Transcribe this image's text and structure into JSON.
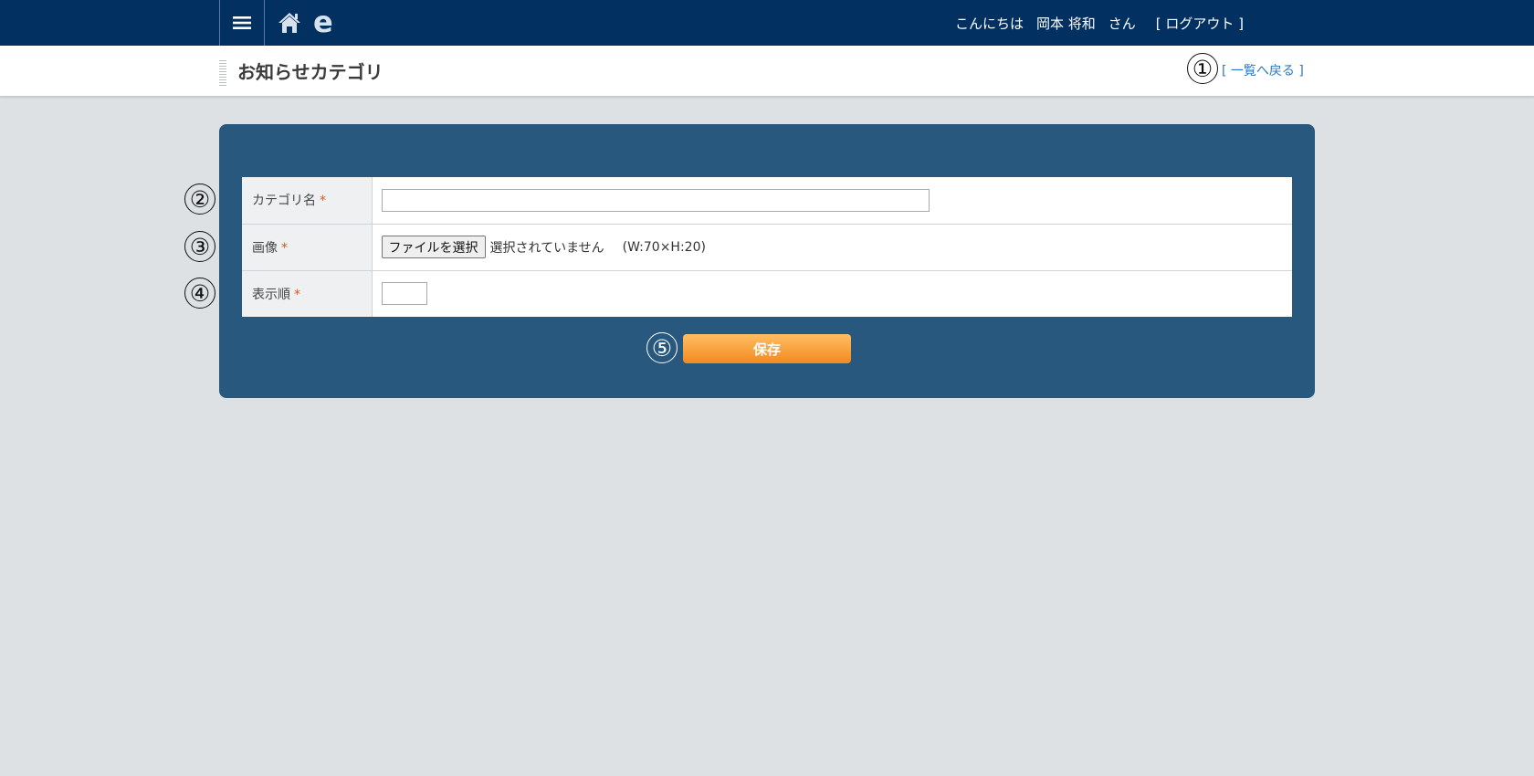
{
  "header": {
    "greeting": "こんにちは",
    "user_name": "岡本 将和",
    "honorific": "さん",
    "logout_label": "[ ログアウト ]",
    "e_logo": "e",
    "icons": {
      "menu": "hamburger-menu-icon",
      "home": "home-icon"
    }
  },
  "subheader": {
    "title": "お知らせカテゴリ",
    "back_label": "[ 一覧へ戻る ]"
  },
  "markers": [
    "①",
    "②",
    "③",
    "④",
    "⑤"
  ],
  "form": {
    "rows": [
      {
        "label": "カテゴリ名",
        "required_mark": "*",
        "value": ""
      },
      {
        "label": "画像",
        "required_mark": "*",
        "file_button_label": "ファイルを選択",
        "file_status": "選択されていません",
        "size_hint": "(W:70×H:20)"
      },
      {
        "label": "表示順",
        "required_mark": "*",
        "value": ""
      }
    ],
    "save_label": "保存"
  },
  "colors": {
    "topbar": "#023061",
    "panel": "#29587f",
    "background": "#dde1e3",
    "save_button": "#f28a21",
    "required": "#e2541a",
    "link": "#2a78c2"
  }
}
